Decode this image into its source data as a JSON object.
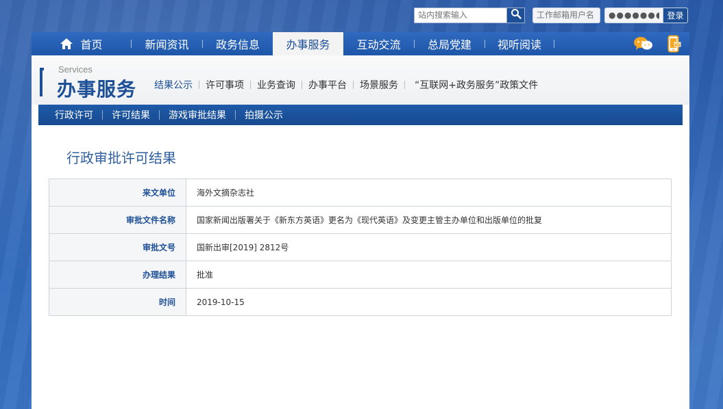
{
  "top": {
    "search_placeholder": "站内搜索输入",
    "user_placeholder": "工作邮箱用户名",
    "password_value": "●●●●●●●●●",
    "login_label": "登录"
  },
  "nav": {
    "items": [
      {
        "label": "首页",
        "icon": "home-icon"
      },
      {
        "label": "新闻资讯"
      },
      {
        "label": "政务信息"
      },
      {
        "label": "办事服务",
        "active": true
      },
      {
        "label": "互动交流"
      },
      {
        "label": "总局党建"
      },
      {
        "label": "视听阅读"
      }
    ],
    "right_icons": [
      "wechat-icon",
      "mobile-icon"
    ]
  },
  "section": {
    "en_title": "Services",
    "cn_title": "办事服务",
    "subnav": [
      "结果公示",
      "许可事项",
      "业务查询",
      "办事平台",
      "场景服务",
      "“互联网+政务服务”政策文件"
    ],
    "tabs": [
      "行政许可",
      "许可结果",
      "游戏审批结果",
      "拍摄公示"
    ]
  },
  "content": {
    "title": "行政审批许可结果",
    "rows": [
      {
        "key": "来文单位",
        "value": "海外文摘杂志社"
      },
      {
        "key": "审批文件名称",
        "value": "国家新闻出版署关于《新东方英语》更名为《现代英语》及变更主管主办单位和出版单位的批复"
      },
      {
        "key": "审批文号",
        "value": "国新出审[2019] 2812号"
      },
      {
        "key": "办理结果",
        "value": "批准"
      },
      {
        "key": "时间",
        "value": "2019-10-15"
      }
    ]
  },
  "colors": {
    "brand_blue": "#1d4f96",
    "nav_blue": "#2f6ac0",
    "accent_orange": "#f5a623"
  }
}
